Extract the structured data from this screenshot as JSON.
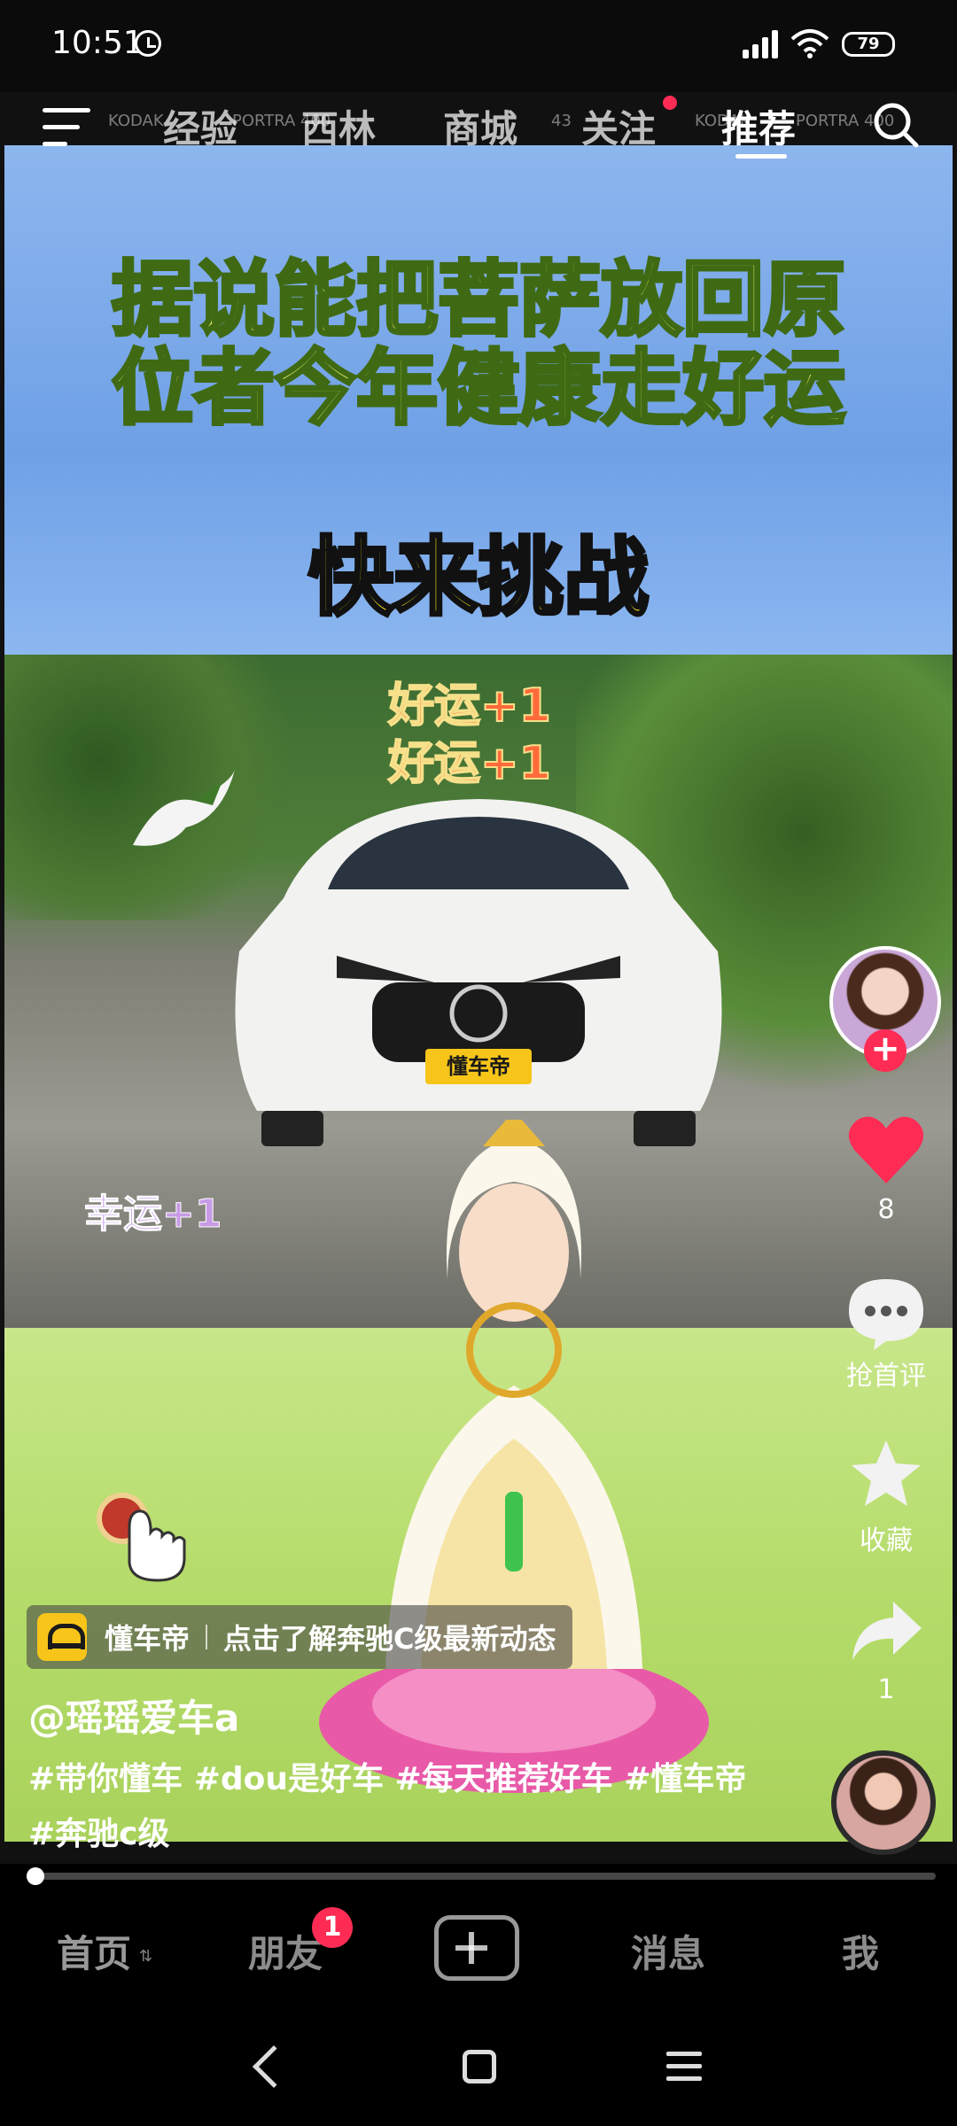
{
  "status_bar": {
    "time": "10:51",
    "battery": "79"
  },
  "top_nav": {
    "tabs": [
      {
        "label": "经验"
      },
      {
        "label": "西林"
      },
      {
        "label": "商城"
      },
      {
        "label": "关注"
      },
      {
        "label": "推荐"
      }
    ],
    "active_tab": "推荐",
    "background_labels": [
      "KODAK",
      "PORTRA 400",
      "43",
      "KODAK",
      "PORTRA 400"
    ]
  },
  "video": {
    "headline_line1": "据说能把菩萨放回原",
    "headline_line2": "位者今年健康走好运",
    "challenge": "快来挑战",
    "luck_text_1": "好运+1",
    "luck_text_2": "好运+1",
    "lucky_text": "幸运+1",
    "plate": "懂车帝"
  },
  "actions": {
    "like_count": "8",
    "comment_label": "抢首评",
    "favorite_label": "收藏",
    "share_count": "1"
  },
  "ad": {
    "brand": "懂车帝",
    "text": "点击了解奔驰C级最新动态"
  },
  "post": {
    "username": "@瑶瑶爱车a",
    "caption": "#带你懂车 #dou是好车 #每天推荐好车 #懂车帝 #奔驰c级"
  },
  "progress": {
    "fraction": 0.01
  },
  "tab_bar": {
    "home": "首页",
    "friends": "朋友",
    "friends_badge": "1",
    "messages": "消息",
    "me": "我"
  },
  "colors": {
    "accent": "#fe2c55",
    "headline": "#e9f06a",
    "challenge": "#ffe81a"
  }
}
